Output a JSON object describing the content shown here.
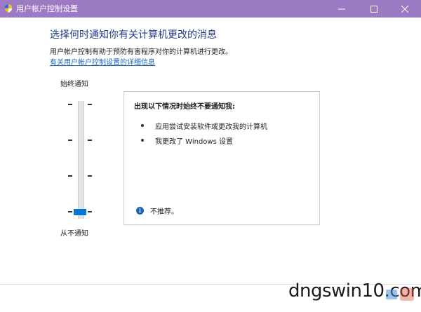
{
  "window": {
    "title": "用户帐户控制设置",
    "title_bar_color": "#9d7ac4"
  },
  "main": {
    "heading": "选择何时通知你有关计算机更改的消息",
    "description": "用户帐户控制有助于预防有害程序对你的计算机进行更改。",
    "more_info_link": "有关用户帐户控制设置的详细信息"
  },
  "slider": {
    "top_label": "始终通知",
    "bottom_label": "从不通知",
    "levels": 4,
    "selected_level": 1,
    "thumb_color": "#0078d7"
  },
  "panel": {
    "heading": "出现以下情况时始终不要通知我:",
    "bullets": [
      "应用尝试安装软件或更改我的计算机",
      "我更改了 Windows 设置"
    ],
    "note": "不推荐。",
    "info_icon": "info-icon",
    "info_color": "#1b64b5"
  },
  "watermark": {
    "text": "dngswin10.com"
  }
}
